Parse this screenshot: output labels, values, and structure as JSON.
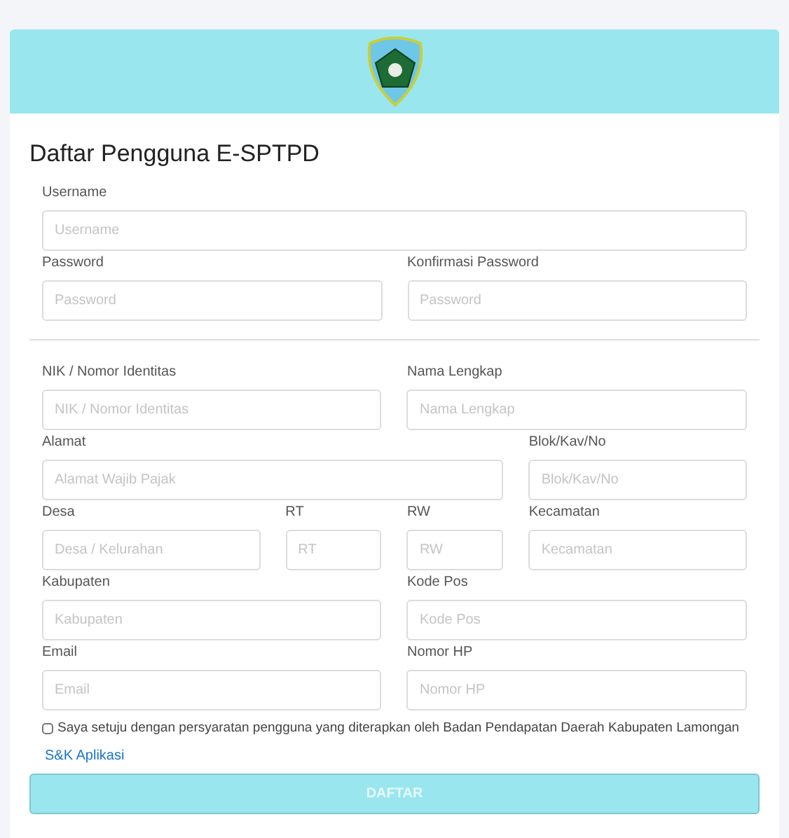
{
  "title": "Daftar Pengguna E-SPTPD",
  "sections": [
    {
      "fields": [
        {
          "label": "Username",
          "placeholder": "Username"
        },
        {
          "label": "Password",
          "placeholder": "Password"
        },
        {
          "label": "Konfirmasi Password",
          "placeholder": "Password"
        }
      ]
    },
    {
      "fields": [
        {
          "label": "NIK / Nomor Identitas",
          "placeholder": "NIK / Nomor Identitas"
        },
        {
          "label": "Nama Lengkap",
          "placeholder": "Nama Lengkap"
        },
        {
          "label": "Alamat",
          "placeholder": "Alamat Wajib Pajak"
        },
        {
          "label": "Blok/Kav/No",
          "placeholder": "Blok/Kav/No"
        },
        {
          "label": "Desa",
          "placeholder": "Desa / Kelurahan"
        },
        {
          "label": "RT",
          "placeholder": "RT"
        },
        {
          "label": "RW",
          "placeholder": "RW"
        },
        {
          "label": "Kecamatan",
          "placeholder": "Kecamatan"
        },
        {
          "label": "Kabupaten",
          "placeholder": "Kabupaten"
        },
        {
          "label": "Kode Pos",
          "placeholder": "Kode Pos"
        },
        {
          "label": "Email",
          "placeholder": "Email"
        },
        {
          "label": "Nomor HP",
          "placeholder": "Nomor HP"
        }
      ]
    }
  ],
  "agreement": {
    "text": "Saya setuju dengan persyaratan pengguna yang diterapkan oleh Badan Pendapatan Daerah Kabupaten Lamongan",
    "checked": false
  },
  "terms_link": "S&K Aplikasi",
  "submit": {
    "label": "DAFTAR",
    "disabled": true
  }
}
